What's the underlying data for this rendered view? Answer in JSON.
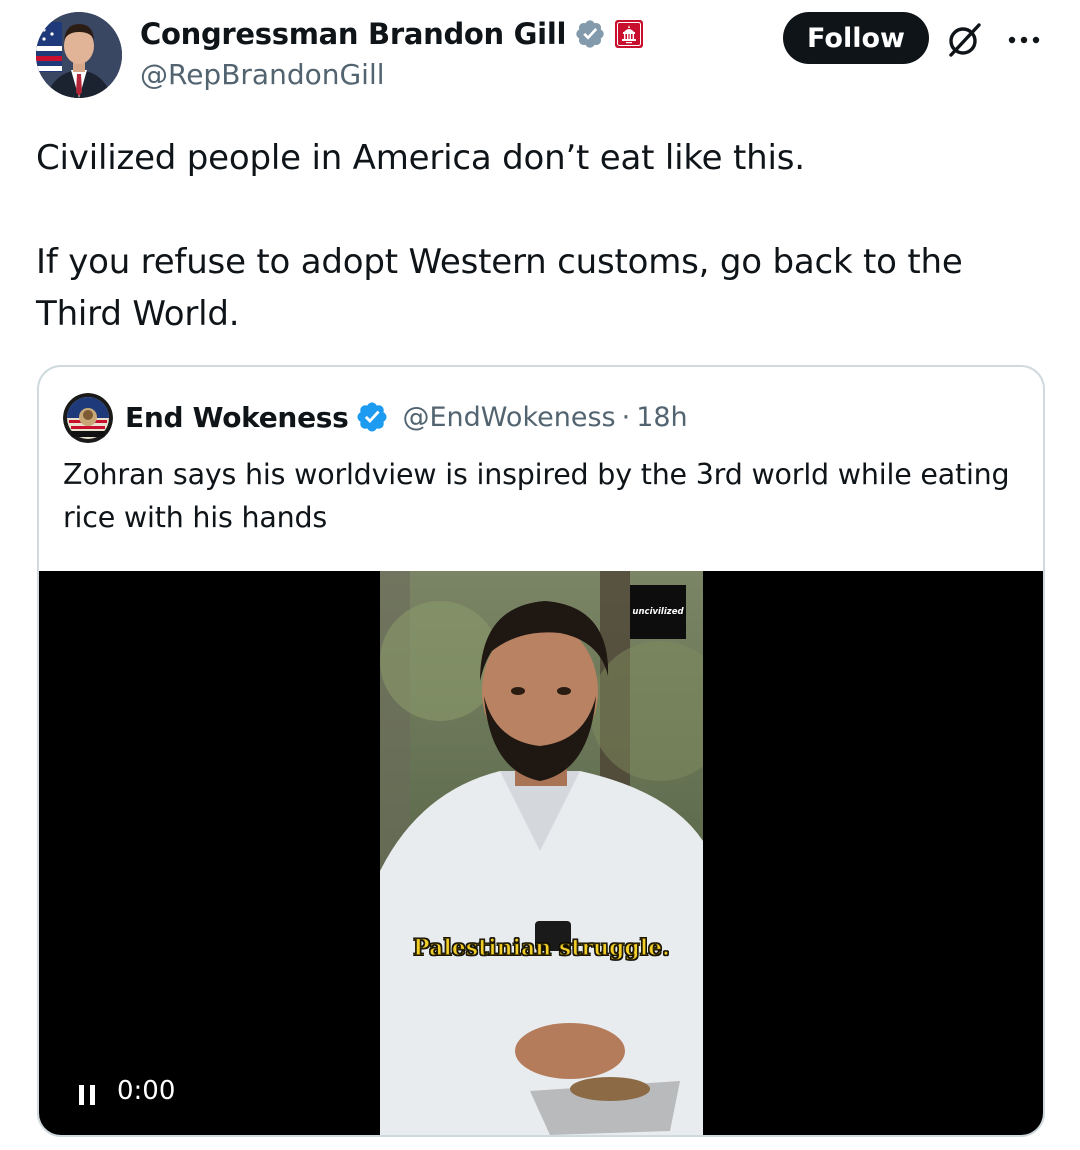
{
  "author": {
    "display_name": "Congressman Brandon Gill",
    "handle": "@RepBrandonGill",
    "verified": true,
    "affiliation_icon": "us-capitol-badge"
  },
  "actions": {
    "follow_label": "Follow",
    "grok_icon": "grok-icon",
    "more_icon": "more-dots-icon"
  },
  "tweet": {
    "text": "Civilized people in America don’t eat like this.\n\nIf you refuse to adopt Western customs, go back to the Third World."
  },
  "quote": {
    "display_name": "End Wokeness",
    "handle": "@EndWokeness",
    "separator": "·",
    "time": "18h",
    "verified": true,
    "text": "Zohran says his worldview is inspired by the 3rd world while eating rice with his hands",
    "video": {
      "brand_tag": "uncivilized",
      "caption": "Palestinian struggle.",
      "timestamp": "0:00",
      "control_icon": "pause-icon"
    }
  },
  "colors": {
    "verified_blue": "#1d9bf0",
    "text_primary": "#0f1419",
    "text_secondary": "#536471",
    "border": "#cfd9de",
    "caption_yellow": "#f3cf2a",
    "affiliation_red": "#c8102e"
  }
}
